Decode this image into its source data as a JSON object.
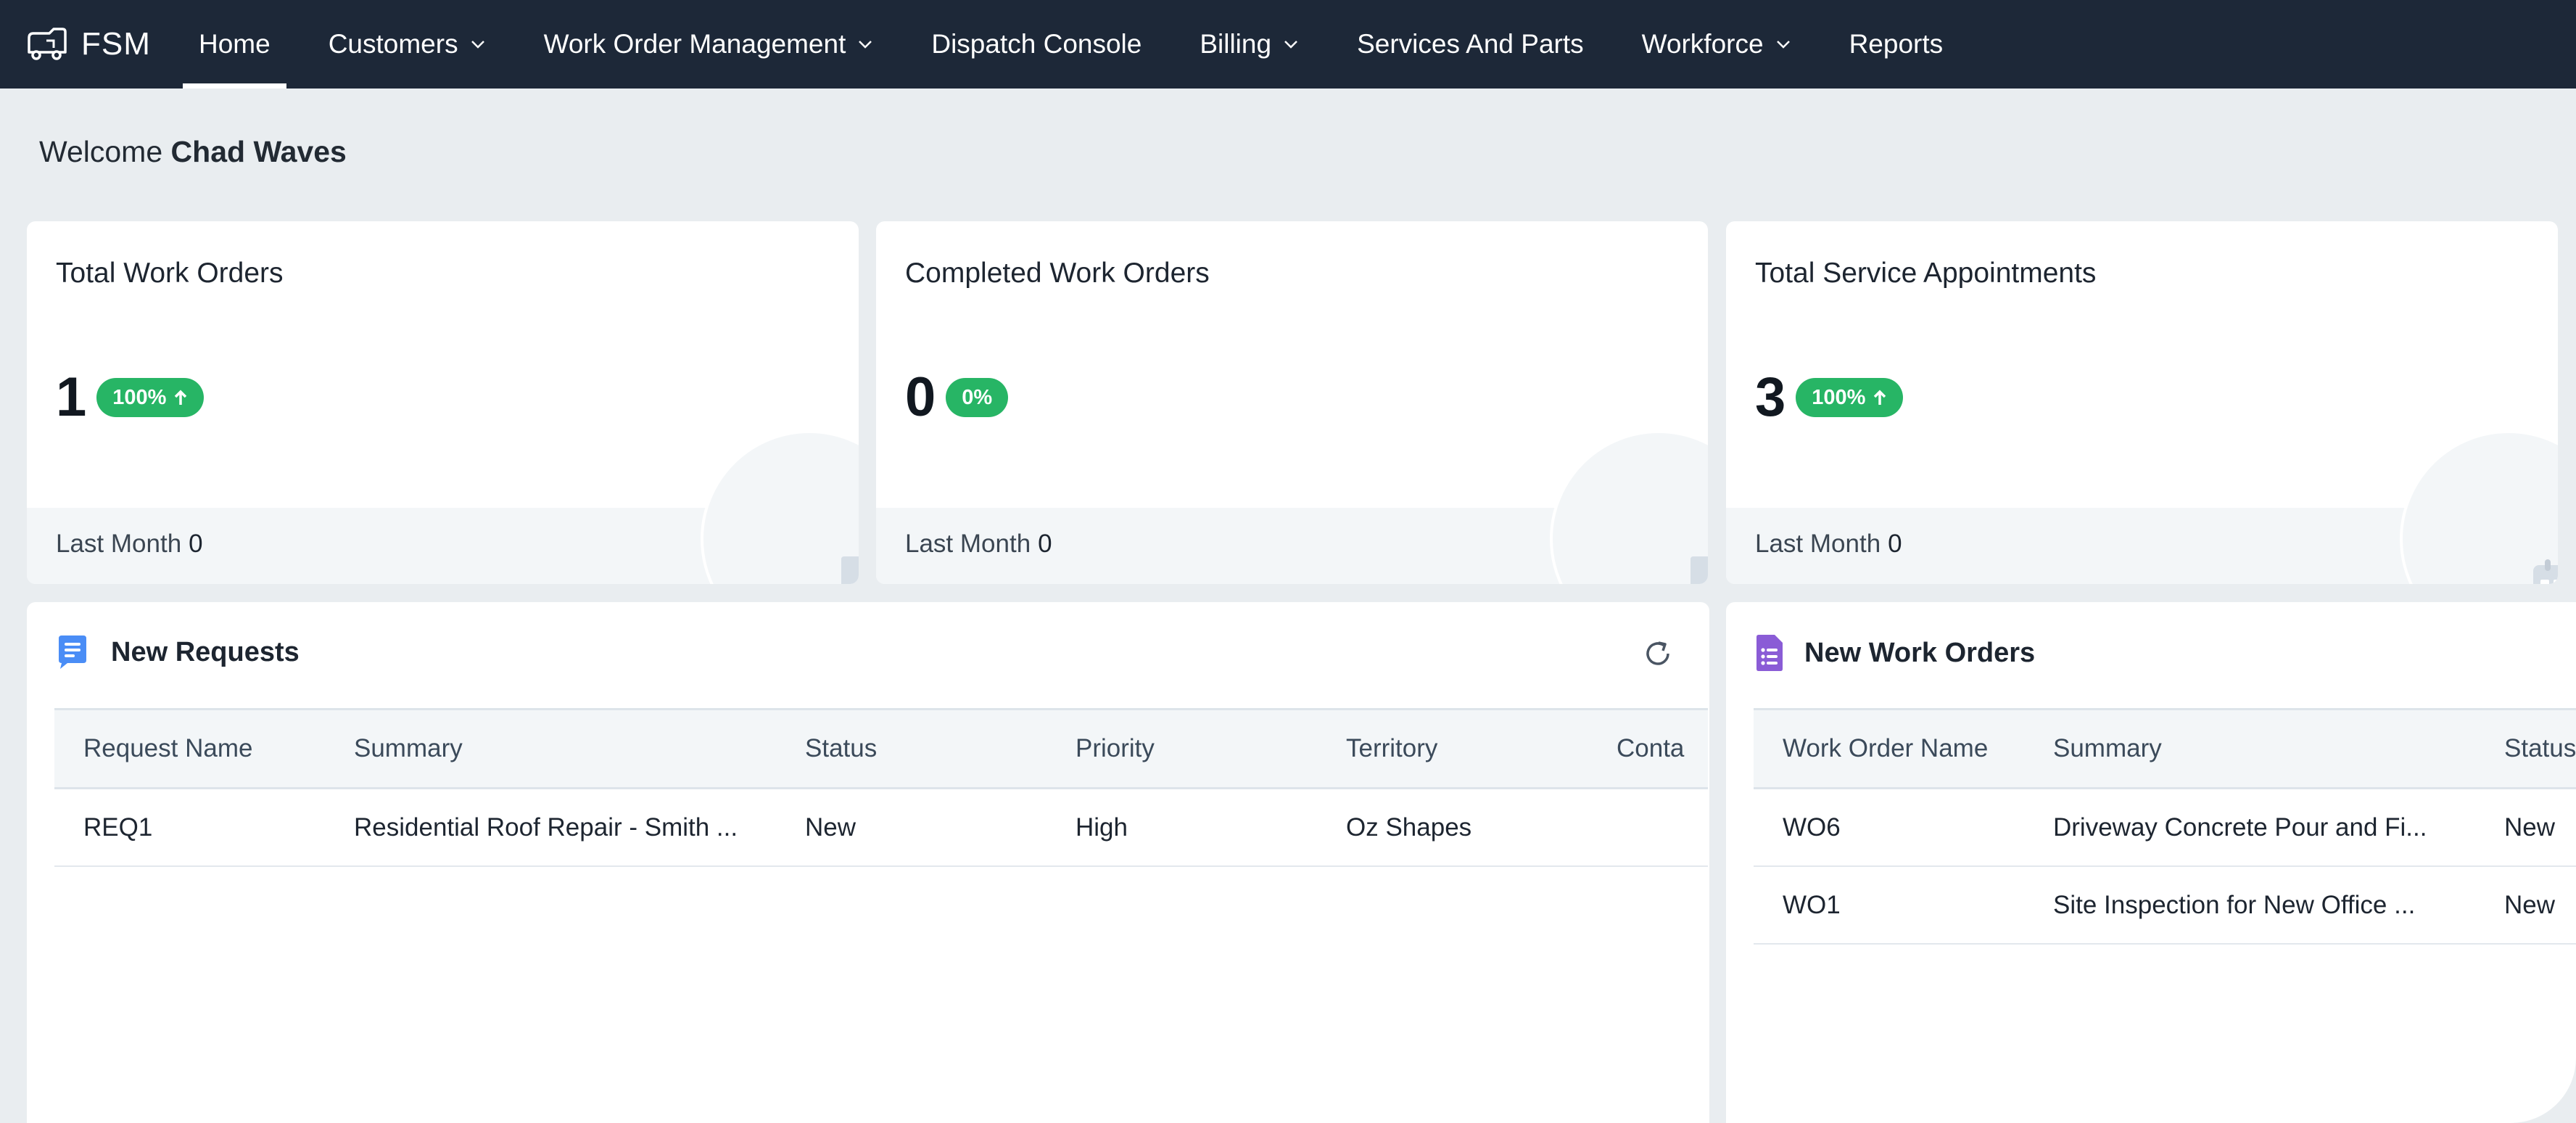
{
  "brand": {
    "name": "FSM"
  },
  "nav": {
    "items": [
      {
        "label": "Home",
        "dropdown": false,
        "active": true
      },
      {
        "label": "Customers",
        "dropdown": true
      },
      {
        "label": "Work Order Management",
        "dropdown": true
      },
      {
        "label": "Dispatch Console",
        "dropdown": false
      },
      {
        "label": "Billing",
        "dropdown": true
      },
      {
        "label": "Services And Parts",
        "dropdown": false
      },
      {
        "label": "Workforce",
        "dropdown": true
      },
      {
        "label": "Reports",
        "dropdown": false
      }
    ]
  },
  "welcome": {
    "prefix": "Welcome",
    "user": "Chad Waves"
  },
  "cards": [
    {
      "title": "Total Work Orders",
      "value": "1",
      "badge": "100%",
      "badge_up": true,
      "footer_label": "Last Month",
      "footer_value": "0",
      "icon": "document-list-icon"
    },
    {
      "title": "Completed Work Orders",
      "value": "0",
      "badge": "0%",
      "badge_up": false,
      "footer_label": "Last Month",
      "footer_value": "0",
      "icon": "document-list-icon"
    },
    {
      "title": "Total Service Appointments",
      "value": "3",
      "badge": "100%",
      "badge_up": true,
      "footer_label": "Last Month",
      "footer_value": "0",
      "icon": "calendar-icon"
    }
  ],
  "requests": {
    "title": "New Requests",
    "icon": "chat-icon",
    "columns": [
      "Request Name",
      "Summary",
      "Status",
      "Priority",
      "Territory",
      "Conta"
    ],
    "rows": [
      [
        "REQ1",
        "Residential Roof Repair - Smith ...",
        "New",
        "High",
        "Oz Shapes",
        ""
      ]
    ]
  },
  "work_orders": {
    "title": "New Work Orders",
    "icon": "document-list-icon",
    "columns": [
      "Work Order Name",
      "Summary",
      "Status"
    ],
    "rows": [
      [
        "WO6",
        "Driveway Concrete Pour and Fi...",
        "New"
      ],
      [
        "WO1",
        "Site Inspection for New Office ...",
        "New"
      ]
    ]
  },
  "colors": {
    "nav_bg": "#1d2838",
    "badge_green": "#27b565",
    "page_bg": "#e9edf0",
    "requests_icon": "#4a8df6",
    "work_orders_icon": "#8a5cd6"
  }
}
